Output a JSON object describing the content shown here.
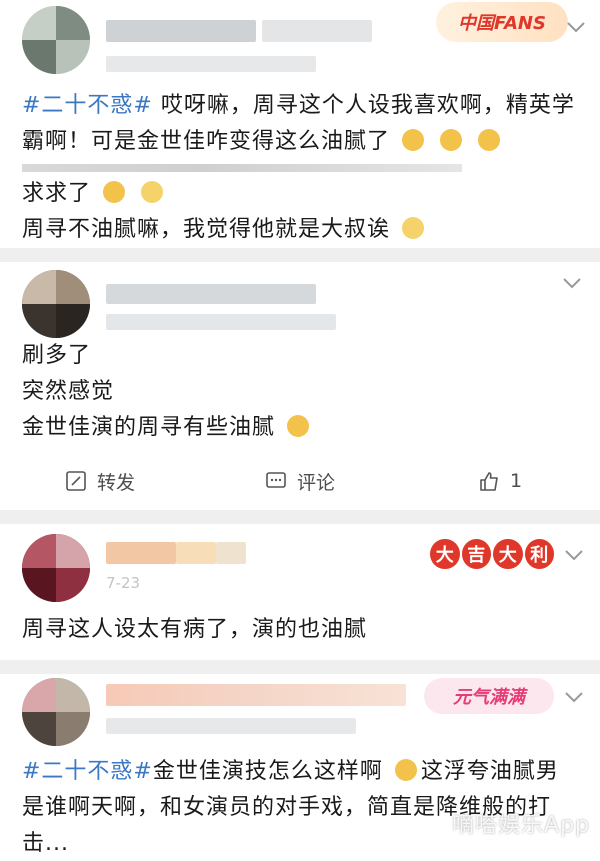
{
  "posts": [
    {
      "hashtag": "#二十不惑#",
      "text_line1": " 哎呀嘛，周寻这个人设我喜欢啊，精英学",
      "text_line2": "霸啊！可是金世佳咋变得这么油腻了",
      "badge": "中国FANS"
    },
    {
      "line1": "求求了",
      "line2": "周寻不油腻嘛，我觉得他就是大叔诶"
    },
    {
      "line1": "刷多了",
      "line2": "突然感觉",
      "line3": "金世佳演的周寻有些油腻",
      "actions": {
        "repost": "转发",
        "comment": "评论",
        "like_count": "1"
      }
    },
    {
      "badge_chars": [
        "大",
        "吉",
        "大",
        "利"
      ],
      "date": "7-23",
      "text": "周寻这人设太有病了，演的也油腻"
    },
    {
      "badge": "元气满满",
      "hashtag": "#二十不惑#",
      "text_line1a": "金世佳演技怎么这样啊",
      "text_line1b": "这浮夸油腻男",
      "text_line2": "是谁啊天啊，和女演员的对手戏，简直是降维般的打",
      "text_line3": "击..."
    }
  ],
  "watermark": "嘀嗒娱乐App",
  "colors": {
    "hashtag": "#3b78c4",
    "separator": "#efefef",
    "text": "#1a1a1a",
    "badge_red": "#e0372b"
  }
}
